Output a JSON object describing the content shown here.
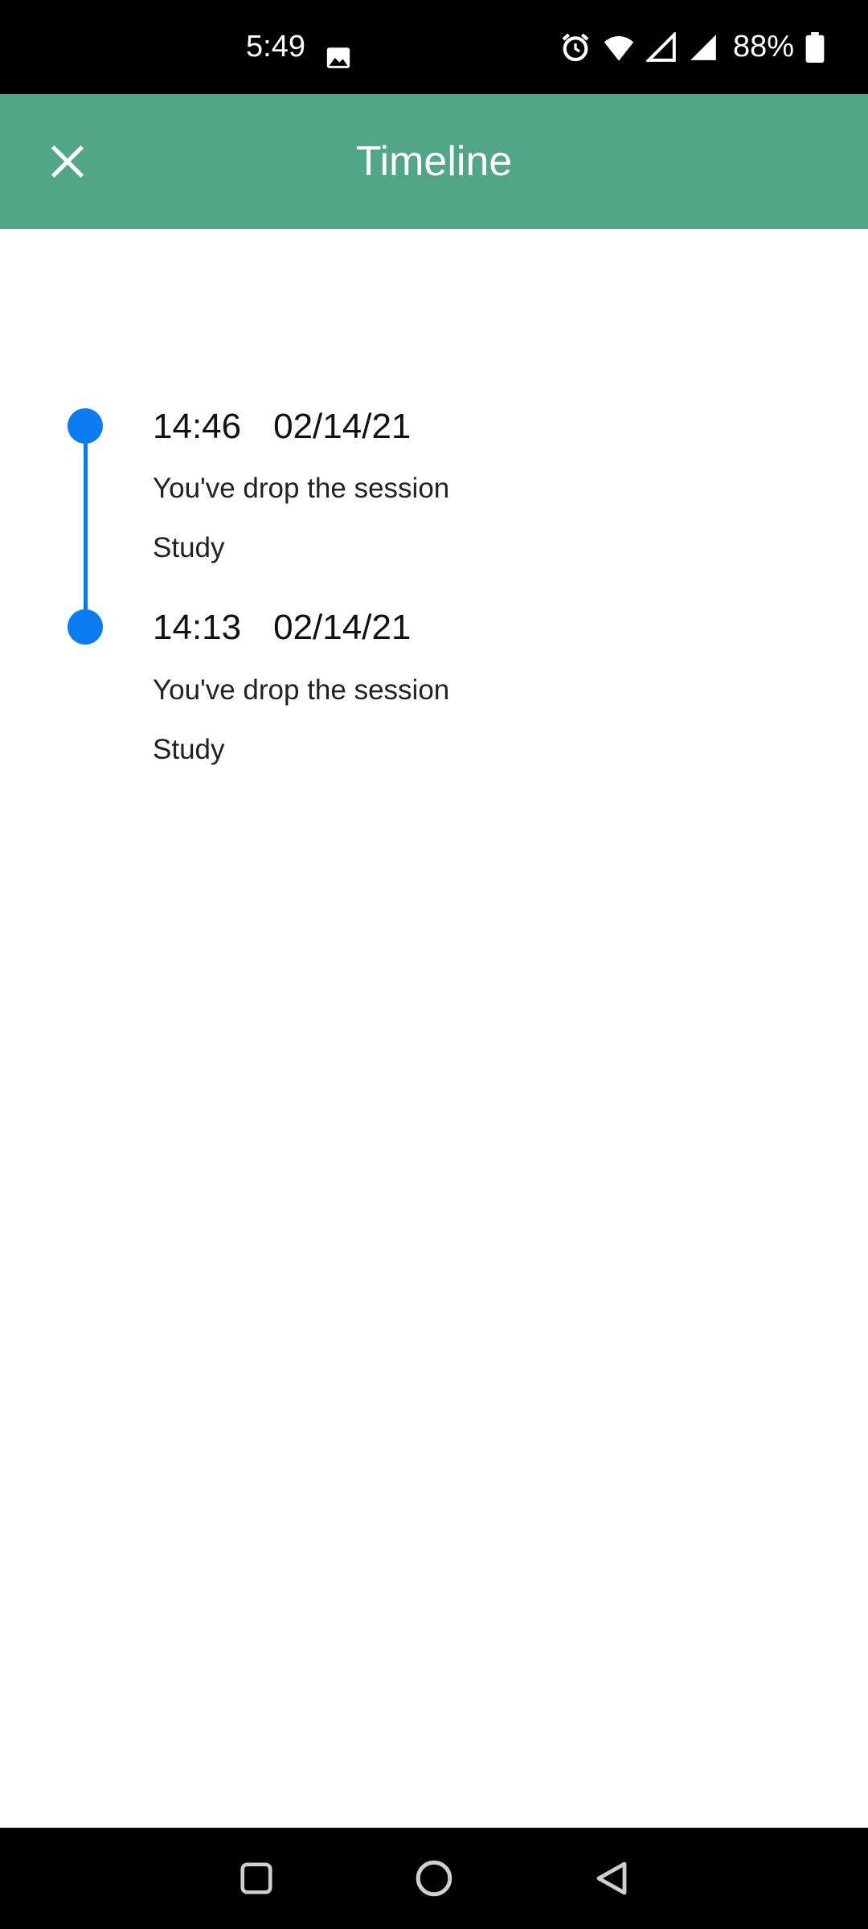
{
  "status_bar": {
    "time": "5:49",
    "battery": "88%",
    "icons": [
      "image-icon",
      "alarm-icon",
      "wifi-icon",
      "signal-icon",
      "signal-icon",
      "battery-icon"
    ]
  },
  "app_bar": {
    "title": "Timeline",
    "close_icon": "close-icon",
    "background_color": "#52a688"
  },
  "timeline": {
    "accent_color": "#0a7cf2",
    "entries": [
      {
        "time": "14:46",
        "date": "02/14/21",
        "message": "You've drop the session",
        "tag": "Study"
      },
      {
        "time": "14:13",
        "date": "02/14/21",
        "message": "You've drop the session",
        "tag": "Study"
      }
    ]
  },
  "nav_bar": {
    "buttons": [
      "recents-button",
      "home-button",
      "back-button"
    ]
  }
}
